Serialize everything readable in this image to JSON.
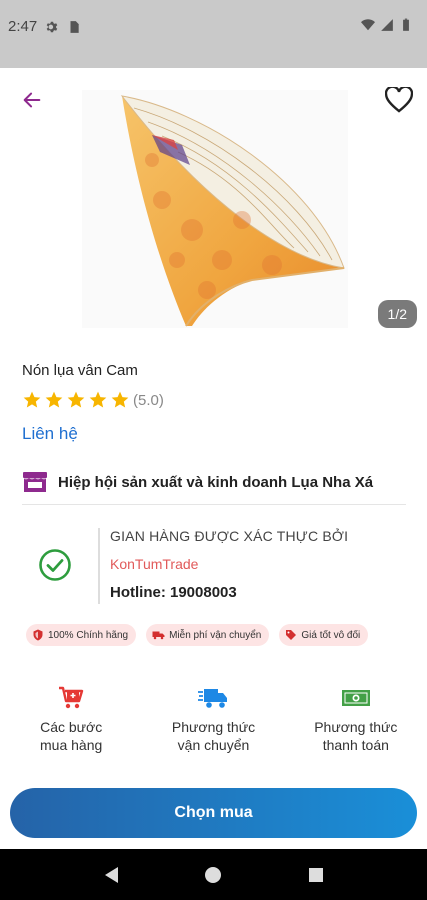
{
  "status_bar": {
    "time": "2:47",
    "icons": [
      "gear-icon",
      "sim-card-icon",
      "wifi-icon",
      "signal-icon",
      "battery-icon"
    ]
  },
  "header": {
    "back_icon": "arrow-left-icon",
    "favorite_icon": "heart-outline-icon",
    "image_counter": "1/2"
  },
  "product": {
    "title": "Nón lụa vân Cam",
    "rating_text": "(5.0)",
    "rating": 5,
    "contact_label": "Liên hệ"
  },
  "seller": {
    "icon": "store-icon",
    "name": "Hiệp hội sản xuất và kinh doanh Lụa Nha Xá"
  },
  "verification": {
    "caption": "GIAN HÀNG ĐƯỢC XÁC THỰC BỞI",
    "org": "KonTumTrade",
    "hotline": "Hotline: 19008003"
  },
  "badges": [
    {
      "icon": "shield-icon",
      "label": "100% Chính hãng"
    },
    {
      "icon": "truck-icon",
      "label": "Miễn phí vận chuyển"
    },
    {
      "icon": "tag-icon",
      "label": "Giá tốt vô đối"
    }
  ],
  "features": [
    {
      "icon": "cart-icon",
      "line1": "Các bước",
      "line2": "mua hàng",
      "color": "#e53935"
    },
    {
      "icon": "delivery-truck-icon",
      "line1": "Phương thức",
      "line2": "vận chuyển",
      "color": "#1e88e5"
    },
    {
      "icon": "money-icon",
      "line1": "Phương thức",
      "line2": "thanh toán",
      "color": "#43a047"
    }
  ],
  "cta": {
    "label": "Chọn mua"
  },
  "colors": {
    "accent_purple": "#8e2a8e",
    "link_blue": "#1f6fd0",
    "verify_green": "#2e9d3e",
    "star_yellow": "#f7b500"
  }
}
